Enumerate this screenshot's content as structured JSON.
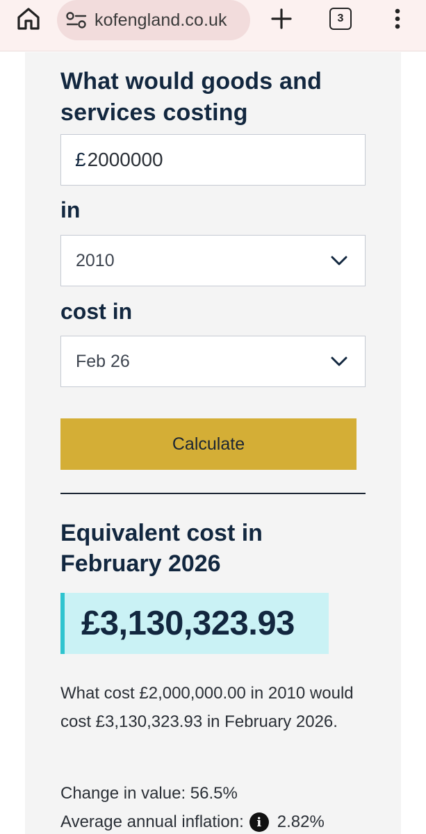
{
  "browser": {
    "url_text": "kofengland.co.uk",
    "tab_count": "3",
    "icons": [
      "home-icon",
      "site-settings-icon",
      "new-tab-icon",
      "tab-switcher-icon",
      "overflow-menu-icon"
    ]
  },
  "form": {
    "heading": "What would goods and services costing",
    "currency_symbol": "£",
    "amount_value": "2000000",
    "in_label": "in",
    "year_selected": "2010",
    "cost_in_label": "cost in",
    "cost_in_selected": "Feb 26",
    "calculate_label": "Calculate"
  },
  "result": {
    "heading": "Equivalent cost in February 2026",
    "value": "£3,130,323.93",
    "summary": "What cost £2,000,000.00 in 2010 would cost £3,130,323.93 in February 2026.",
    "change_label": "Change in value: 56.5%",
    "inflation_label": "Average annual inflation:",
    "inflation_value": "2.82%"
  },
  "colors": {
    "brand_text": "#12273f",
    "button": "#d4ae36",
    "result_bg": "#caf2f5",
    "result_accent": "#2ec4cf",
    "browser_bar": "#fcf1f0"
  }
}
